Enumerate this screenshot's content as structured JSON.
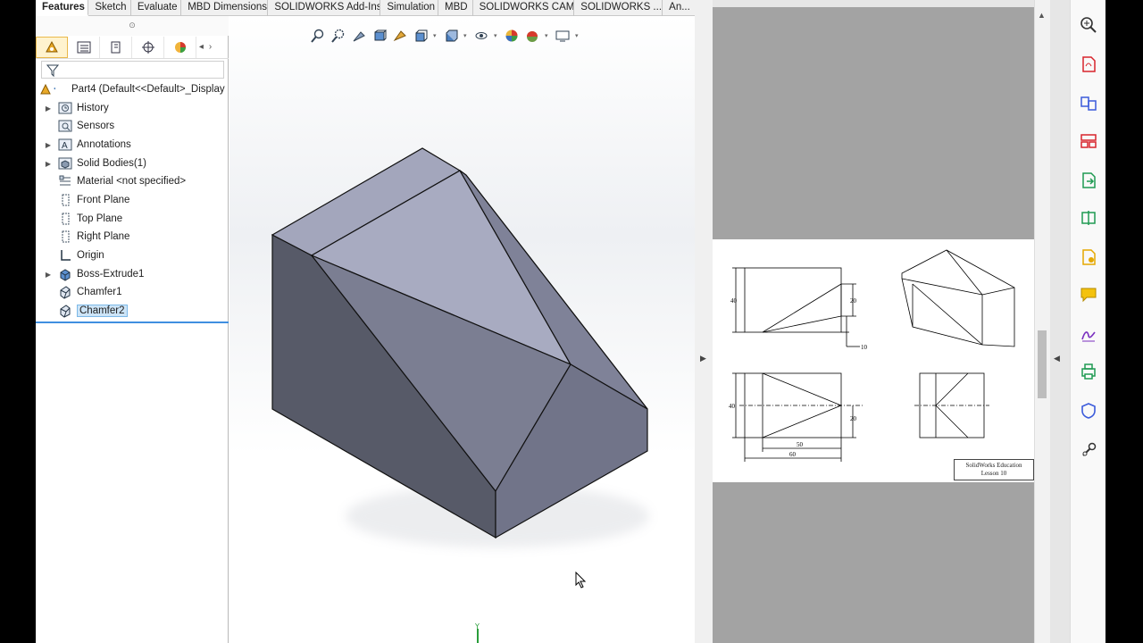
{
  "solidworks": {
    "tabs": [
      {
        "label": "Features",
        "active": true
      },
      {
        "label": "Sketch",
        "active": false
      },
      {
        "label": "Evaluate",
        "active": false
      },
      {
        "label": "MBD Dimensions",
        "active": false
      },
      {
        "label": "SOLIDWORKS Add-Ins",
        "active": false
      },
      {
        "label": "Simulation",
        "active": false
      },
      {
        "label": "MBD",
        "active": false
      },
      {
        "label": "SOLIDWORKS CAM",
        "active": false
      },
      {
        "label": "SOLIDWORKS ...",
        "active": false
      },
      {
        "label": "An...",
        "active": false
      }
    ],
    "feature_tree": {
      "grip_glyph": "⊙",
      "root": "Part4  (Default<<Default>_Display",
      "items": [
        {
          "label": "History",
          "icon": "history-icon",
          "expandable": true
        },
        {
          "label": "Sensors",
          "icon": "sensors-icon",
          "expandable": false
        },
        {
          "label": "Annotations",
          "icon": "annotations-icon",
          "expandable": true
        },
        {
          "label": "Solid Bodies(1)",
          "icon": "solid-bodies-icon",
          "expandable": true
        },
        {
          "label": "Material <not specified>",
          "icon": "material-icon",
          "expandable": false
        },
        {
          "label": "Front Plane",
          "icon": "plane-icon",
          "expandable": false
        },
        {
          "label": "Top Plane",
          "icon": "plane-icon",
          "expandable": false
        },
        {
          "label": "Right Plane",
          "icon": "plane-icon",
          "expandable": false
        },
        {
          "label": "Origin",
          "icon": "origin-icon",
          "expandable": false
        },
        {
          "label": "Boss-Extrude1",
          "icon": "extrude-icon",
          "expandable": true
        },
        {
          "label": "Chamfer1",
          "icon": "chamfer-icon",
          "expandable": false
        },
        {
          "label": "Chamfer2",
          "icon": "chamfer-icon",
          "expandable": false,
          "selected": true
        }
      ]
    }
  },
  "pdf": {
    "dims": {
      "d40a": "40",
      "d20a": "20",
      "d10": "10",
      "d40b": "40",
      "d20b": "20",
      "d50": "50",
      "d60": "60"
    },
    "title_block": [
      "SolidWorks Education",
      "Lesson 10"
    ]
  },
  "colors": {
    "tab_bar": "#f0f0f0",
    "selection": "#cce4f7",
    "model_face_dark": "#5b5e6b",
    "model_face_light": "#a9acc0",
    "pdf_gray": "#a3a3a3"
  }
}
